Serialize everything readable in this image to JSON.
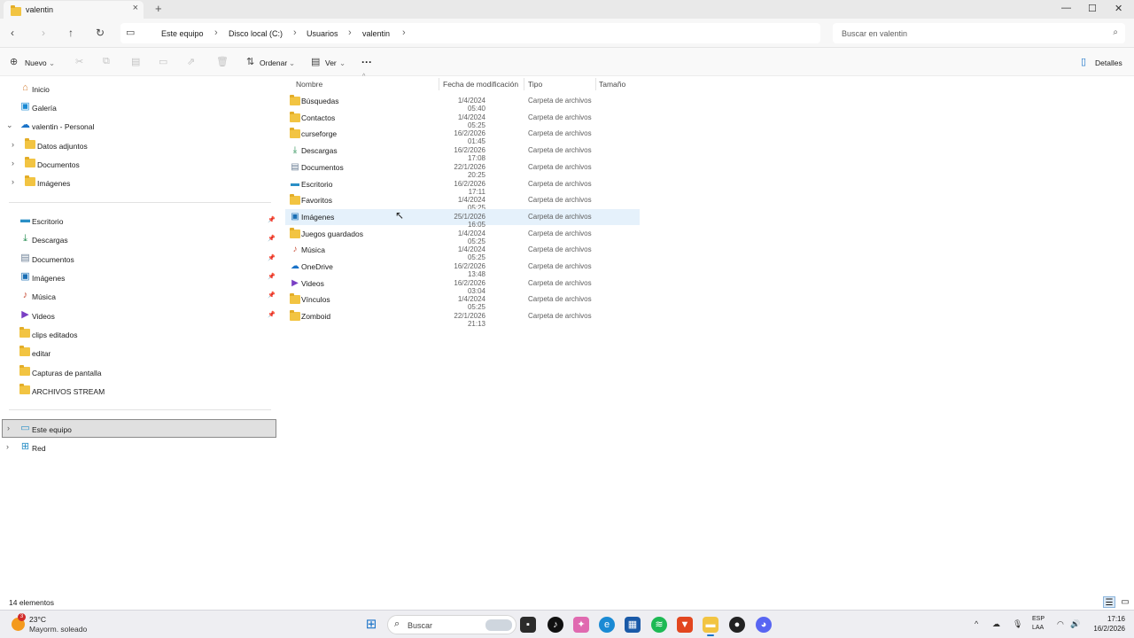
{
  "window": {
    "tab_title": "valentin",
    "tab_close": "×",
    "new_tab": "+",
    "minimize": "—",
    "maximize": "☐",
    "close": "✕"
  },
  "address": {
    "breadcrumbs": [
      "Este equipo",
      "Disco local (C:)",
      "Usuarios",
      "valentin"
    ],
    "separator": "›",
    "search_placeholder": "Buscar en valentin"
  },
  "toolbar": {
    "new_label": "Nuevo",
    "sort_label": "Ordenar",
    "view_label": "Ver",
    "more_label": "···",
    "details_label": "Detalles"
  },
  "sidebar": {
    "top": [
      {
        "label": "Inicio",
        "icon": "home-icon"
      },
      {
        "label": "Galería",
        "icon": "gallery-icon"
      },
      {
        "label": "valentin - Personal",
        "icon": "onedrive-icon",
        "expanded": true
      }
    ],
    "onedrive_children": [
      {
        "label": "Datos adjuntos"
      },
      {
        "label": "Documentos"
      },
      {
        "label": "Imágenes"
      }
    ],
    "pinned": [
      {
        "label": "Escritorio",
        "icon": "desktop-icon",
        "pinned": true
      },
      {
        "label": "Descargas",
        "icon": "downloads-icon",
        "pinned": true
      },
      {
        "label": "Documentos",
        "icon": "documents-icon",
        "pinned": true
      },
      {
        "label": "Imágenes",
        "icon": "pictures-icon",
        "pinned": true
      },
      {
        "label": "Música",
        "icon": "music-icon",
        "pinned": true
      },
      {
        "label": "Videos",
        "icon": "videos-icon",
        "pinned": true
      },
      {
        "label": "clips editados",
        "icon": "folder-icon",
        "pinned": false
      },
      {
        "label": "editar",
        "icon": "folder-icon",
        "pinned": false
      },
      {
        "label": "Capturas de pantalla",
        "icon": "folder-icon",
        "pinned": false
      },
      {
        "label": "ARCHIVOS STREAM",
        "icon": "folder-icon",
        "pinned": false
      }
    ],
    "bottom": [
      {
        "label": "Este equipo",
        "icon": "pc-icon",
        "selected": true
      },
      {
        "label": "Red",
        "icon": "network-icon",
        "selected": false
      }
    ]
  },
  "filelist": {
    "columns": [
      "Nombre",
      "Fecha de modificación",
      "Tipo",
      "Tamaño"
    ],
    "rows": [
      {
        "name": "Búsquedas",
        "date": "1/4/2024 05:40",
        "type": "Carpeta de archivos",
        "icon": "folder-icon"
      },
      {
        "name": "Contactos",
        "date": "1/4/2024 05:25",
        "type": "Carpeta de archivos",
        "icon": "folder-icon"
      },
      {
        "name": "curseforge",
        "date": "16/2/2026 01:45",
        "type": "Carpeta de archivos",
        "icon": "folder-icon"
      },
      {
        "name": "Descargas",
        "date": "16/2/2026 17:08",
        "type": "Carpeta de archivos",
        "icon": "downloads-icon"
      },
      {
        "name": "Documentos",
        "date": "22/1/2026 20:25",
        "type": "Carpeta de archivos",
        "icon": "documents-icon"
      },
      {
        "name": "Escritorio",
        "date": "16/2/2026 17:11",
        "type": "Carpeta de archivos",
        "icon": "desktop-icon"
      },
      {
        "name": "Favoritos",
        "date": "1/4/2024 05:25",
        "type": "Carpeta de archivos",
        "icon": "folder-icon"
      },
      {
        "name": "Imágenes",
        "date": "25/1/2026 16:05",
        "type": "Carpeta de archivos",
        "icon": "pictures-icon",
        "hover": true
      },
      {
        "name": "Juegos guardados",
        "date": "1/4/2024 05:25",
        "type": "Carpeta de archivos",
        "icon": "folder-icon"
      },
      {
        "name": "Música",
        "date": "1/4/2024 05:25",
        "type": "Carpeta de archivos",
        "icon": "music-icon"
      },
      {
        "name": "OneDrive",
        "date": "16/2/2026 13:48",
        "type": "Carpeta de archivos",
        "icon": "onedrive-icon"
      },
      {
        "name": "Videos",
        "date": "16/2/2026 03:04",
        "type": "Carpeta de archivos",
        "icon": "videos-icon"
      },
      {
        "name": "Vínculos",
        "date": "1/4/2024 05:25",
        "type": "Carpeta de archivos",
        "icon": "folder-icon"
      },
      {
        "name": "Zomboid",
        "date": "22/1/2026 21:13",
        "type": "Carpeta de archivos",
        "icon": "folder-icon"
      }
    ]
  },
  "status": {
    "count_label": "14 elementos"
  },
  "taskbar": {
    "temperature": "23°C",
    "weather": "Mayorm. soleado",
    "weather_badge": "3",
    "search_placeholder": "Buscar",
    "lang_1": "ESP",
    "lang_2": "LAA",
    "time": "17:16",
    "date": "16/2/2026"
  },
  "colors": {
    "accent": "#1a73c8",
    "folder": "#f2c442",
    "hover_row": "#e5f1fb",
    "selected_nav": "#e0e0e0"
  }
}
